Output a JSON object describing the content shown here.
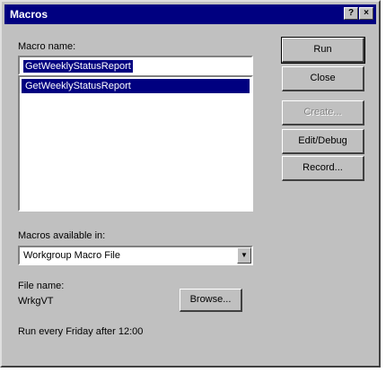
{
  "window": {
    "title": "Macros",
    "help_button": "?",
    "close_button": "×"
  },
  "macro_name": {
    "label": "Macro name:",
    "value": "GetWeeklyStatusReport"
  },
  "macro_list": {
    "items": [
      "GetWeeklyStatusReport"
    ]
  },
  "available_in": {
    "label": "Macros available in:",
    "value": "Workgroup Macro File"
  },
  "file_name": {
    "label": "File name:",
    "value": "WrkgVT"
  },
  "buttons": {
    "run": "Run",
    "close": "Close",
    "create": "Create...",
    "edit_debug": "Edit/Debug",
    "record": "Record...",
    "browse": "Browse..."
  },
  "description": "Run every Friday after 12:00",
  "colors": {
    "titlebar": "#000080",
    "face": "#c0c0c0",
    "selection": "#000080"
  }
}
